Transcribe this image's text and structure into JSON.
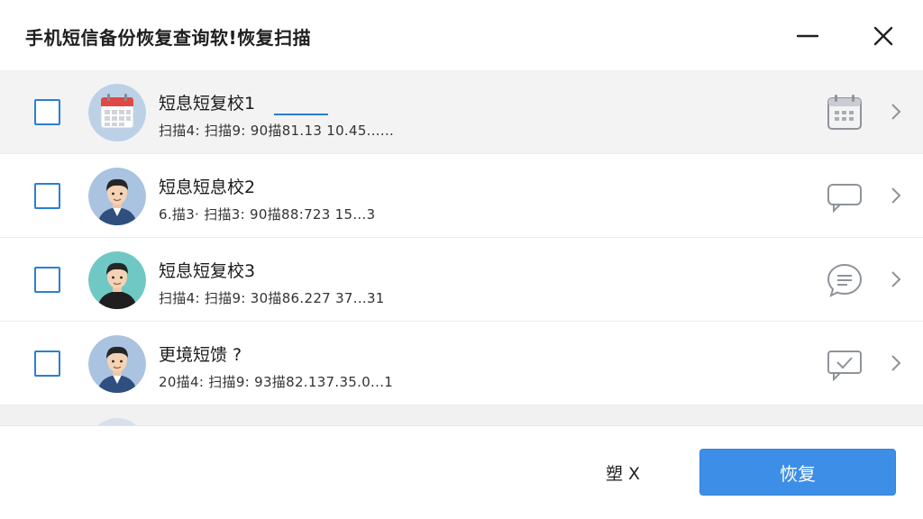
{
  "window": {
    "title": "手机短信备份恢复查询软!恢复扫描"
  },
  "messages": [
    {
      "name": "短息短复校1",
      "meta": "扫描4: 扫描9: 90描81.13 10.45......",
      "avatar": "calendar",
      "type_icon": "calendar-icon",
      "highlighted": true
    },
    {
      "name": "短息短息校2",
      "meta": "6.描3· 扫描3: 90描88:723 15...3",
      "avatar": "man-blue",
      "type_icon": "chat-bubble-icon",
      "highlighted": false
    },
    {
      "name": "短息短复校3",
      "meta": "扫描4: 扫描9: 30描86.227 37...31",
      "avatar": "man-teal",
      "type_icon": "message-circle-icon",
      "highlighted": false
    },
    {
      "name": "更境短馈 ?",
      "meta": "20描4: 扫描9: 93描82.137.35.0...1",
      "avatar": "man-blue",
      "type_icon": "message-check-icon",
      "highlighted": false
    }
  ],
  "footer": {
    "cancel_label": "塑 X",
    "restore_label": "恢复"
  },
  "colors": {
    "accent": "#3d8ee6",
    "checkbox_border": "#2a7fd4",
    "highlight_row": "#f3f3f4"
  }
}
